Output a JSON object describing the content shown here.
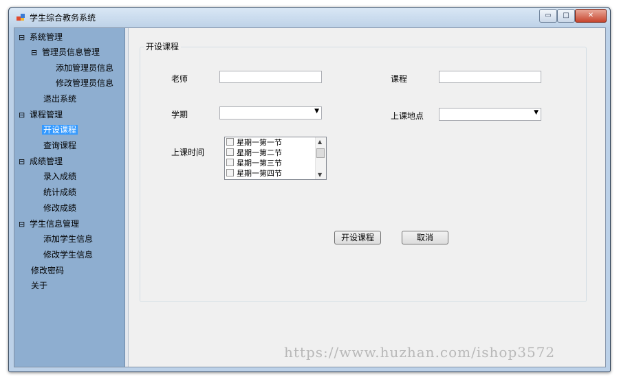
{
  "window": {
    "title": "学生综合教务系统",
    "controls": {
      "minimize": "▭",
      "maximize": "□",
      "close": "✕"
    }
  },
  "sidebar": {
    "items": [
      {
        "label": "系统管理",
        "toggle": "⊟"
      },
      {
        "label": "管理员信息管理",
        "toggle": "⊟"
      },
      {
        "label": "添加管理员信息"
      },
      {
        "label": "修改管理员信息"
      },
      {
        "label": "退出系统"
      },
      {
        "label": "课程管理",
        "toggle": "⊟"
      },
      {
        "label": "开设课程",
        "selected": true
      },
      {
        "label": "查询课程"
      },
      {
        "label": "成绩管理",
        "toggle": "⊟"
      },
      {
        "label": "录入成绩"
      },
      {
        "label": "统计成绩"
      },
      {
        "label": "修改成绩"
      },
      {
        "label": "学生信息管理",
        "toggle": "⊟"
      },
      {
        "label": "添加学生信息"
      },
      {
        "label": "修改学生信息"
      },
      {
        "label": "修改密码"
      },
      {
        "label": "关于"
      }
    ]
  },
  "form": {
    "group_title": "开设课程",
    "teacher_label": "老师",
    "teacher_value": "",
    "course_label": "课程",
    "course_value": "",
    "term_label": "学期",
    "term_value": "",
    "location_label": "上课地点",
    "location_value": "",
    "time_label": "上课时间",
    "time_options": [
      "星期一第一节",
      "星期一第二节",
      "星期一第三节",
      "星期一第四节"
    ],
    "submit_label": "开设课程",
    "cancel_label": "取消"
  },
  "watermark": "https://www.huzhan.com/ishop3572"
}
